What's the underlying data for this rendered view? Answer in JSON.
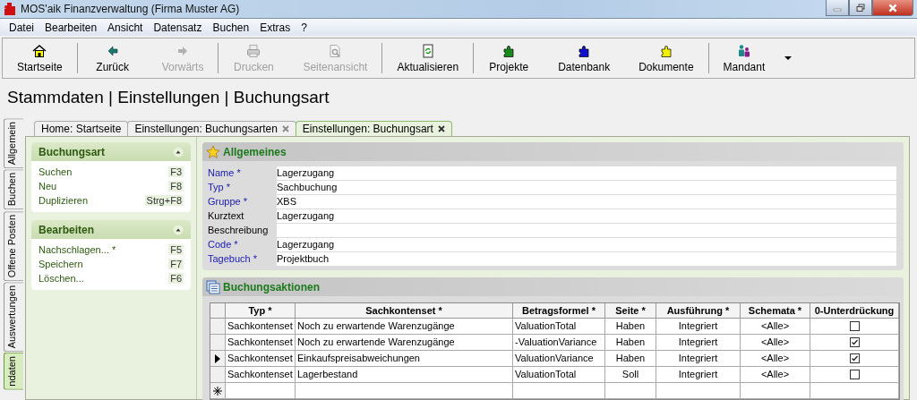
{
  "window": {
    "title": "MOS'aik Finanzverwaltung (Firma Muster AG)"
  },
  "menu": [
    "Datei",
    "Bearbeiten",
    "Ansicht",
    "Datensatz",
    "Buchen",
    "Extras",
    "?"
  ],
  "toolbar": {
    "groups": [
      [
        {
          "label": "Startseite",
          "kind": "home",
          "disabled": false
        }
      ],
      [
        {
          "label": "Zurück",
          "kind": "back",
          "disabled": false
        },
        {
          "label": "Vorwärts",
          "kind": "forward",
          "disabled": true
        }
      ],
      [
        {
          "label": "Drucken",
          "kind": "print",
          "disabled": true
        },
        {
          "label": "Seitenansicht",
          "kind": "preview",
          "disabled": true
        }
      ],
      [
        {
          "label": "Aktualisieren",
          "kind": "refresh",
          "disabled": false
        }
      ],
      [
        {
          "label": "Projekte",
          "kind": "puzzle",
          "color": "#1a8a1a",
          "disabled": false
        },
        {
          "label": "Datenbank",
          "kind": "puzzle",
          "color": "#1010d0",
          "disabled": false
        },
        {
          "label": "Dokumente",
          "kind": "puzzle",
          "color": "#f0f000",
          "disabled": false
        }
      ],
      [
        {
          "label": "Mandant",
          "kind": "people",
          "disabled": false
        }
      ]
    ]
  },
  "heading": "Stammdaten | Einstellungen | Buchungsart",
  "side_tabs": [
    {
      "label": "Allgemein",
      "selected": false
    },
    {
      "label": "Buchen",
      "selected": false
    },
    {
      "label": "Offene Posten",
      "selected": false
    },
    {
      "label": "Auswertungen",
      "selected": false
    },
    {
      "label": "ndaten",
      "selected": true
    }
  ],
  "doc_tabs": [
    {
      "label": "Home: Startseite",
      "closable": false,
      "selected": false
    },
    {
      "label": "Einstellungen: Buchungsarten",
      "closable": true,
      "selected": false
    },
    {
      "label": "Einstellungen: Buchungsart",
      "closable": true,
      "selected": true
    }
  ],
  "task_panels": [
    {
      "title": "Buchungsart",
      "expanded": true,
      "items": [
        {
          "label": "Suchen",
          "shortcut": "F3"
        },
        {
          "label": "Neu",
          "shortcut": "F8"
        },
        {
          "label": "Duplizieren",
          "shortcut": "Strg+F8"
        }
      ]
    },
    {
      "title": "Bearbeiten",
      "expanded": true,
      "items": [
        {
          "label": "Nachschlagen... *",
          "shortcut": "F5"
        },
        {
          "label": "Speichern",
          "shortcut": "F7"
        },
        {
          "label": "Löschen...",
          "shortcut": "F6"
        }
      ]
    }
  ],
  "general": {
    "title": "Allgemeines",
    "fields": [
      {
        "label": "Name *",
        "value": "Lagerzugang",
        "required": true
      },
      {
        "label": "Typ *",
        "value": "Sachbuchung",
        "required": true
      },
      {
        "label": "Gruppe *",
        "value": "XBS",
        "required": true
      },
      {
        "label": "Kurztext",
        "value": "Lagerzugang",
        "required": false
      },
      {
        "label": "Beschreibung",
        "required": false
      },
      {
        "label": "Code *",
        "value": "Lagerzugang",
        "required": true
      },
      {
        "label": "Tagebuch *",
        "value": "Projektbuch",
        "required": true
      }
    ]
  },
  "actions": {
    "title": "Buchungsaktionen",
    "columns": [
      "Typ *",
      "Sachkontenset *",
      "Betragsformel *",
      "Seite *",
      "Ausführung *",
      "Schemata *",
      "0-Unterdrückung"
    ],
    "rows": [
      {
        "selected": false,
        "typ": "Sachkontenset",
        "sachkontenset": "Noch zu erwartende Warenzugänge",
        "betragsformel": "ValuationTotal",
        "seite": "Haben",
        "ausfuehrung": "Integriert",
        "schemata": "<Alle>",
        "checked": false
      },
      {
        "selected": false,
        "typ": "Sachkontenset",
        "sachkontenset": "Noch zu erwartende Warenzugänge",
        "betragsformel": "-ValuationVariance",
        "seite": "Haben",
        "ausfuehrung": "Integriert",
        "schemata": "<Alle>",
        "checked": true
      },
      {
        "selected": true,
        "typ": "Sachkontenset",
        "sachkontenset": "Einkaufspreisabweichungen",
        "betragsformel": "ValuationVariance",
        "seite": "Haben",
        "ausfuehrung": "Integriert",
        "schemata": "<Alle>",
        "checked": true
      },
      {
        "selected": false,
        "typ": "Sachkontenset",
        "sachkontenset": "Lagerbestand",
        "betragsformel": "ValuationTotal",
        "seite": "Soll",
        "ausfuehrung": "Integriert",
        "schemata": "<Alle>",
        "checked": false
      }
    ]
  }
}
